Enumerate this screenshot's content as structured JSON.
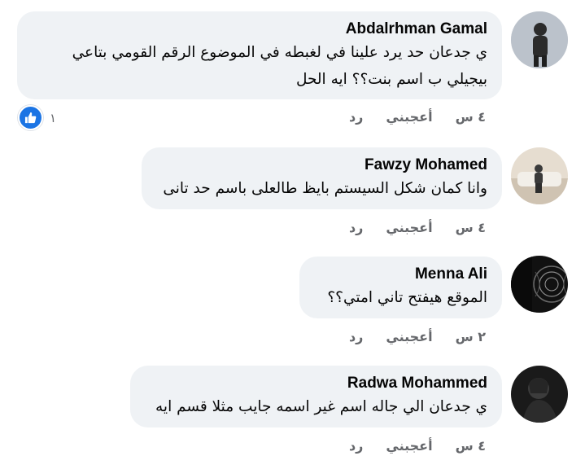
{
  "comments": [
    {
      "author": "Abdalrhman Gamal",
      "lines": [
        "ي جدعان حد يرد علينا في لغبطه في الموضوع الرقم القومي بتاعي",
        "بيجيلي ب اسم بنت؟؟ ايه الحل"
      ],
      "time": "٤ س",
      "like_label": "أعجبني",
      "reply_label": "رد",
      "reaction_count": "١",
      "reaction_icon": "like-icon",
      "avatar_colors": {
        "bg": "#c9ced6",
        "figure": "#2b2b2b"
      }
    },
    {
      "author": "Fawzy Mohamed",
      "lines": [
        "وانا كمان شكل السيستم بايظ طالعلى باسم حد تانى"
      ],
      "time": "٤ س",
      "like_label": "أعجبني",
      "reply_label": "رد",
      "avatar_colors": {
        "bg": "#d9cfc0",
        "figure": "#3a3a3a"
      }
    },
    {
      "author": "Menna Ali",
      "lines": [
        "الموقع هيفتح تاني امتي؟؟"
      ],
      "time": "٢ س",
      "like_label": "أعجبني",
      "reply_label": "رد",
      "avatar_colors": {
        "bg": "#151515",
        "figure": "#7a7a7a"
      }
    },
    {
      "author": "Radwa Mohammed",
      "lines": [
        "ي جدعان الي جاله اسم غير اسمه جايب مثلا قسم ايه"
      ],
      "time": "٤ س",
      "like_label": "أعجبني",
      "reply_label": "رد",
      "avatar_colors": {
        "bg": "#1a1a1a",
        "figure": "#555555"
      }
    }
  ],
  "colors": {
    "bubble": "#eff2f5",
    "meta": "#65676b",
    "like_blue": "#1b74e4"
  }
}
